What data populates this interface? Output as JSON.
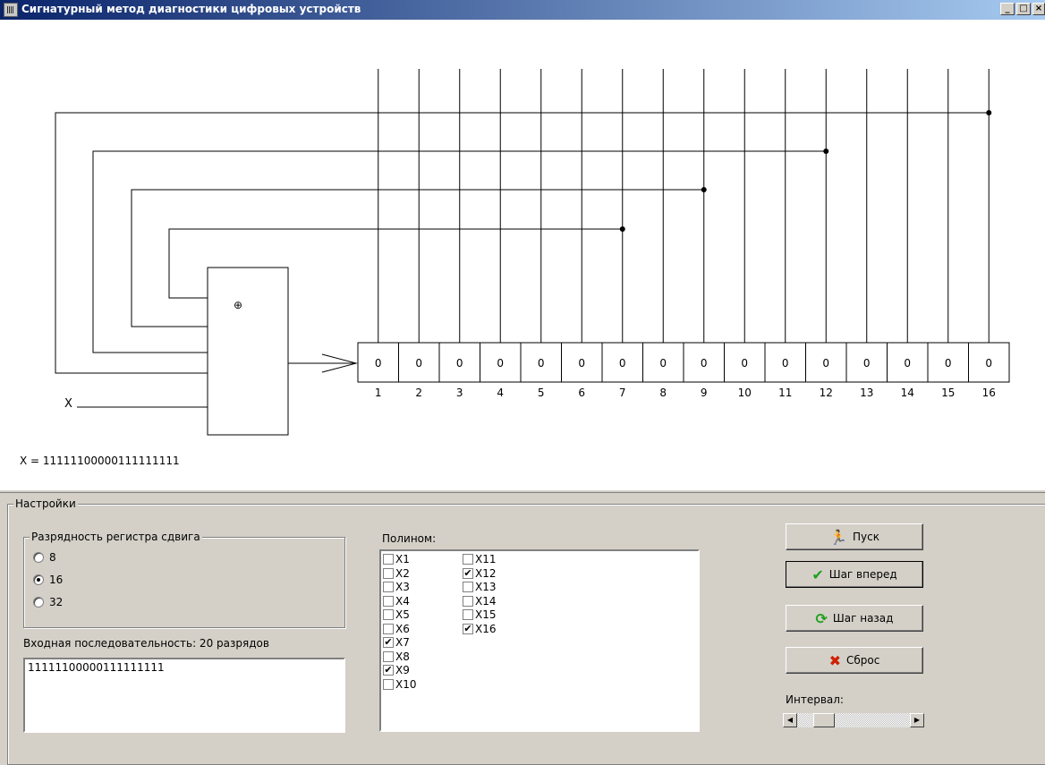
{
  "window": {
    "title": "Сигнатурный метод диагностики цифровых устройств",
    "min": "_",
    "max": "□",
    "close": "×"
  },
  "diagram": {
    "xor_symbol": "⊕",
    "input_label": "X",
    "sequence_line": "X =  11111100000111111111",
    "registers": [
      "0",
      "0",
      "0",
      "0",
      "0",
      "0",
      "0",
      "0",
      "0",
      "0",
      "0",
      "0",
      "0",
      "0",
      "0",
      "0"
    ],
    "indices": [
      "1",
      "2",
      "3",
      "4",
      "5",
      "6",
      "7",
      "8",
      "9",
      "10",
      "11",
      "12",
      "13",
      "14",
      "15",
      "16"
    ],
    "taps": [
      16,
      12,
      9,
      7
    ]
  },
  "settings": {
    "title": "Настройки",
    "register_group": {
      "title": "Разрядность регистра сдвига",
      "options": [
        {
          "label": "8",
          "selected": false
        },
        {
          "label": "16",
          "selected": true
        },
        {
          "label": "32",
          "selected": false
        }
      ]
    },
    "input_label": "Входная последовательность: 20 разрядов",
    "input_value": "11111100000111111111",
    "polynom_label": "Полином:",
    "polynom_col1": [
      {
        "label": "X1",
        "checked": false
      },
      {
        "label": "X2",
        "checked": false
      },
      {
        "label": "X3",
        "checked": false
      },
      {
        "label": "X4",
        "checked": false
      },
      {
        "label": "X5",
        "checked": false
      },
      {
        "label": "X6",
        "checked": false
      },
      {
        "label": "X7",
        "checked": true
      },
      {
        "label": "X8",
        "checked": false
      },
      {
        "label": "X9",
        "checked": true
      },
      {
        "label": "X10",
        "checked": false
      }
    ],
    "polynom_col2": [
      {
        "label": "X11",
        "checked": false
      },
      {
        "label": "X12",
        "checked": true
      },
      {
        "label": "X13",
        "checked": false
      },
      {
        "label": "X14",
        "checked": false
      },
      {
        "label": "X15",
        "checked": false
      },
      {
        "label": "X16",
        "checked": true
      }
    ],
    "buttons": {
      "start": "Пуск",
      "step_forward": "Шаг вперед",
      "step_back": "Шаг назад",
      "reset": "Сброс"
    },
    "interval_label": "Интервал:",
    "interval_value": 0.17
  }
}
